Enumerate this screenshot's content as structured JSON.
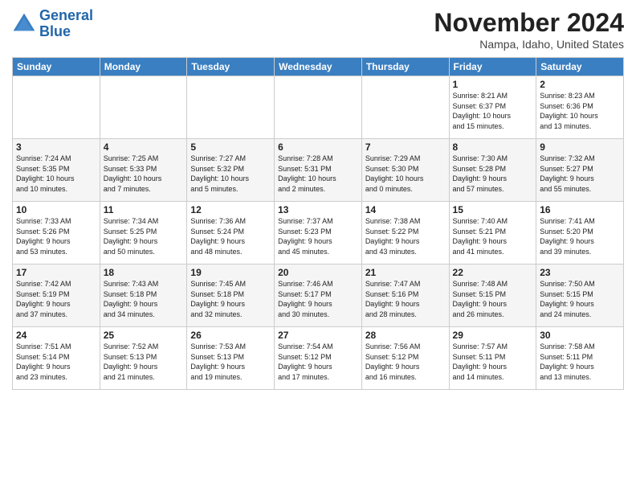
{
  "header": {
    "logo_text_line1": "General",
    "logo_text_line2": "Blue",
    "month_title": "November 2024",
    "location": "Nampa, Idaho, United States"
  },
  "days_of_week": [
    "Sunday",
    "Monday",
    "Tuesday",
    "Wednesday",
    "Thursday",
    "Friday",
    "Saturday"
  ],
  "weeks": [
    [
      {
        "day": "",
        "info": ""
      },
      {
        "day": "",
        "info": ""
      },
      {
        "day": "",
        "info": ""
      },
      {
        "day": "",
        "info": ""
      },
      {
        "day": "",
        "info": ""
      },
      {
        "day": "1",
        "info": "Sunrise: 8:21 AM\nSunset: 6:37 PM\nDaylight: 10 hours\nand 15 minutes."
      },
      {
        "day": "2",
        "info": "Sunrise: 8:23 AM\nSunset: 6:36 PM\nDaylight: 10 hours\nand 13 minutes."
      }
    ],
    [
      {
        "day": "3",
        "info": "Sunrise: 7:24 AM\nSunset: 5:35 PM\nDaylight: 10 hours\nand 10 minutes."
      },
      {
        "day": "4",
        "info": "Sunrise: 7:25 AM\nSunset: 5:33 PM\nDaylight: 10 hours\nand 7 minutes."
      },
      {
        "day": "5",
        "info": "Sunrise: 7:27 AM\nSunset: 5:32 PM\nDaylight: 10 hours\nand 5 minutes."
      },
      {
        "day": "6",
        "info": "Sunrise: 7:28 AM\nSunset: 5:31 PM\nDaylight: 10 hours\nand 2 minutes."
      },
      {
        "day": "7",
        "info": "Sunrise: 7:29 AM\nSunset: 5:30 PM\nDaylight: 10 hours\nand 0 minutes."
      },
      {
        "day": "8",
        "info": "Sunrise: 7:30 AM\nSunset: 5:28 PM\nDaylight: 9 hours\nand 57 minutes."
      },
      {
        "day": "9",
        "info": "Sunrise: 7:32 AM\nSunset: 5:27 PM\nDaylight: 9 hours\nand 55 minutes."
      }
    ],
    [
      {
        "day": "10",
        "info": "Sunrise: 7:33 AM\nSunset: 5:26 PM\nDaylight: 9 hours\nand 53 minutes."
      },
      {
        "day": "11",
        "info": "Sunrise: 7:34 AM\nSunset: 5:25 PM\nDaylight: 9 hours\nand 50 minutes."
      },
      {
        "day": "12",
        "info": "Sunrise: 7:36 AM\nSunset: 5:24 PM\nDaylight: 9 hours\nand 48 minutes."
      },
      {
        "day": "13",
        "info": "Sunrise: 7:37 AM\nSunset: 5:23 PM\nDaylight: 9 hours\nand 45 minutes."
      },
      {
        "day": "14",
        "info": "Sunrise: 7:38 AM\nSunset: 5:22 PM\nDaylight: 9 hours\nand 43 minutes."
      },
      {
        "day": "15",
        "info": "Sunrise: 7:40 AM\nSunset: 5:21 PM\nDaylight: 9 hours\nand 41 minutes."
      },
      {
        "day": "16",
        "info": "Sunrise: 7:41 AM\nSunset: 5:20 PM\nDaylight: 9 hours\nand 39 minutes."
      }
    ],
    [
      {
        "day": "17",
        "info": "Sunrise: 7:42 AM\nSunset: 5:19 PM\nDaylight: 9 hours\nand 37 minutes."
      },
      {
        "day": "18",
        "info": "Sunrise: 7:43 AM\nSunset: 5:18 PM\nDaylight: 9 hours\nand 34 minutes."
      },
      {
        "day": "19",
        "info": "Sunrise: 7:45 AM\nSunset: 5:18 PM\nDaylight: 9 hours\nand 32 minutes."
      },
      {
        "day": "20",
        "info": "Sunrise: 7:46 AM\nSunset: 5:17 PM\nDaylight: 9 hours\nand 30 minutes."
      },
      {
        "day": "21",
        "info": "Sunrise: 7:47 AM\nSunset: 5:16 PM\nDaylight: 9 hours\nand 28 minutes."
      },
      {
        "day": "22",
        "info": "Sunrise: 7:48 AM\nSunset: 5:15 PM\nDaylight: 9 hours\nand 26 minutes."
      },
      {
        "day": "23",
        "info": "Sunrise: 7:50 AM\nSunset: 5:15 PM\nDaylight: 9 hours\nand 24 minutes."
      }
    ],
    [
      {
        "day": "24",
        "info": "Sunrise: 7:51 AM\nSunset: 5:14 PM\nDaylight: 9 hours\nand 23 minutes."
      },
      {
        "day": "25",
        "info": "Sunrise: 7:52 AM\nSunset: 5:13 PM\nDaylight: 9 hours\nand 21 minutes."
      },
      {
        "day": "26",
        "info": "Sunrise: 7:53 AM\nSunset: 5:13 PM\nDaylight: 9 hours\nand 19 minutes."
      },
      {
        "day": "27",
        "info": "Sunrise: 7:54 AM\nSunset: 5:12 PM\nDaylight: 9 hours\nand 17 minutes."
      },
      {
        "day": "28",
        "info": "Sunrise: 7:56 AM\nSunset: 5:12 PM\nDaylight: 9 hours\nand 16 minutes."
      },
      {
        "day": "29",
        "info": "Sunrise: 7:57 AM\nSunset: 5:11 PM\nDaylight: 9 hours\nand 14 minutes."
      },
      {
        "day": "30",
        "info": "Sunrise: 7:58 AM\nSunset: 5:11 PM\nDaylight: 9 hours\nand 13 minutes."
      }
    ]
  ]
}
